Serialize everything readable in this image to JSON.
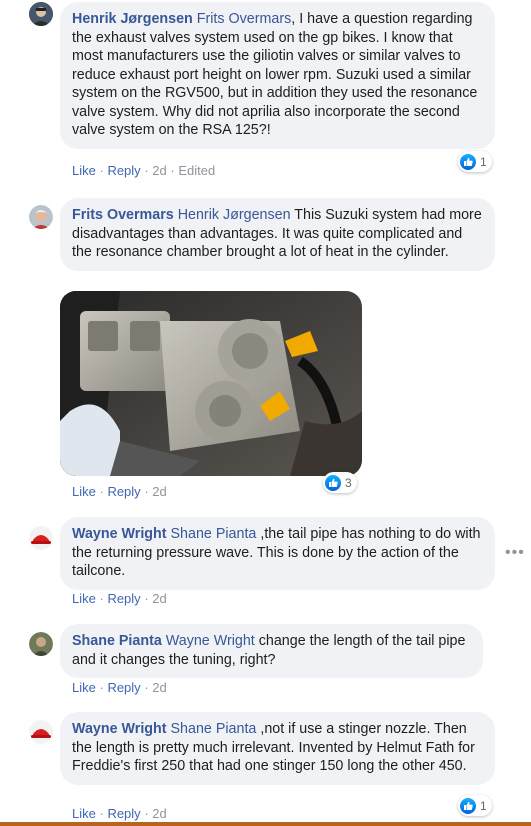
{
  "comments": [
    {
      "author": "Henrik Jørgensen",
      "mention": "Frits Overmars",
      "text": ", I have a question regarding the exhaust valves system used on the gp bikes. I know that most manufacturers use the giliotin valves or similar valves to reduce exhaust port height on lower rpm. Suzuki used a similar system on the RGV500, but in addition they used the resonance valve system. Why did not aprilia also incorporate the second valve system on the RSA 125?!",
      "like": "Like",
      "reply": "Reply",
      "time": "2d",
      "edited": "Edited",
      "reactions": "1"
    },
    {
      "author": "Frits Overmars",
      "mention": "Henrik Jørgensen",
      "text": " This Suzuki system had more disadvantages than advantages. It was quite complicated and the resonance chamber brought a lot of heat in the cylinder.",
      "like": "Like",
      "reply": "Reply",
      "time": "2d",
      "reactions": "3"
    },
    {
      "author": "Wayne Wright",
      "mention": "Shane Pianta",
      "text": " ,the tail pipe has nothing to do with the returning pressure wave. This is done by the action of the tailcone.",
      "like": "Like",
      "reply": "Reply",
      "time": "2d"
    },
    {
      "author": "Shane Pianta",
      "mention": "Wayne Wright",
      "text": " change the length of the tail pipe and it changes the tuning, right?",
      "like": "Like",
      "reply": "Reply",
      "time": "2d"
    },
    {
      "author": "Wayne Wright",
      "mention": "Shane Pianta",
      "text": " ,not if use a stinger nozzle. Then the length is pretty much irrelevant. Invented by Helmut Fath for Freddie's first 250 that had one stinger 150 long the other 450.",
      "like": "Like",
      "reply": "Reply",
      "time": "2d",
      "reactions": "1"
    }
  ],
  "more_options": "•••",
  "colors": {
    "link": "#385898",
    "bubble": "#f0f2f5",
    "action": "#4267b2",
    "meta": "#90949c"
  },
  "icons": {
    "like": "like-thumb-icon",
    "more": "more-options-icon"
  }
}
